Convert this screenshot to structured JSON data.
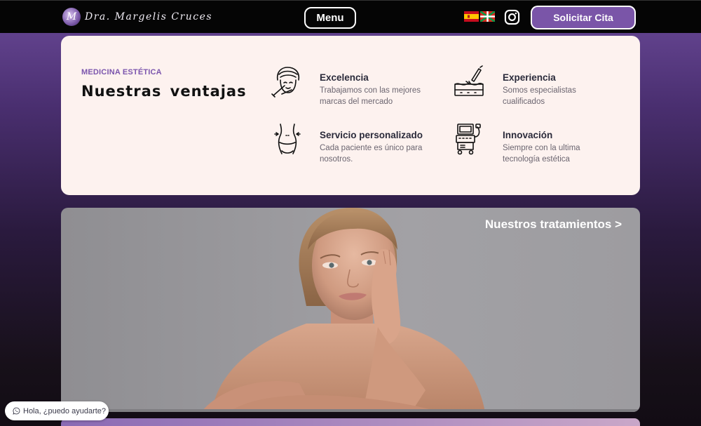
{
  "header": {
    "logo_initial": "M",
    "logo_text": "Dra. Margelis Cruces",
    "menu_label": "Menu",
    "flags": [
      "spanish-flag-icon",
      "basque-flag-icon"
    ],
    "instagram_icon": "instagram-icon",
    "cta_label": "Solicitar Cita"
  },
  "advantages": {
    "eyebrow": "MEDICINA ESTÉTICA",
    "title": "Nuestras ventajas",
    "items": [
      {
        "icon": "face-treatment-icon",
        "title": "Excelencia",
        "desc": "Trabajamos con las mejores marcas del mercado"
      },
      {
        "icon": "skin-laser-icon",
        "title": "Experiencia",
        "desc": "Somos especialistas cualificados"
      },
      {
        "icon": "body-contour-icon",
        "title": "Servicio personalizado",
        "desc": "Cada paciente es único para nosotros."
      },
      {
        "icon": "ultrasound-machine-icon",
        "title": "Innovación",
        "desc": "Siempre con la ultima tecnología estética"
      }
    ]
  },
  "hero": {
    "link_label": "Nuestros tratamientos >",
    "image": "woman-portrait-photo"
  },
  "chat": {
    "icon": "whatsapp-icon",
    "label": "Hola, ¿puedo ayudarte?"
  },
  "colors": {
    "accent": "#7a55a8",
    "card_bg": "#fdf2ef",
    "header_bg": "#050505"
  }
}
